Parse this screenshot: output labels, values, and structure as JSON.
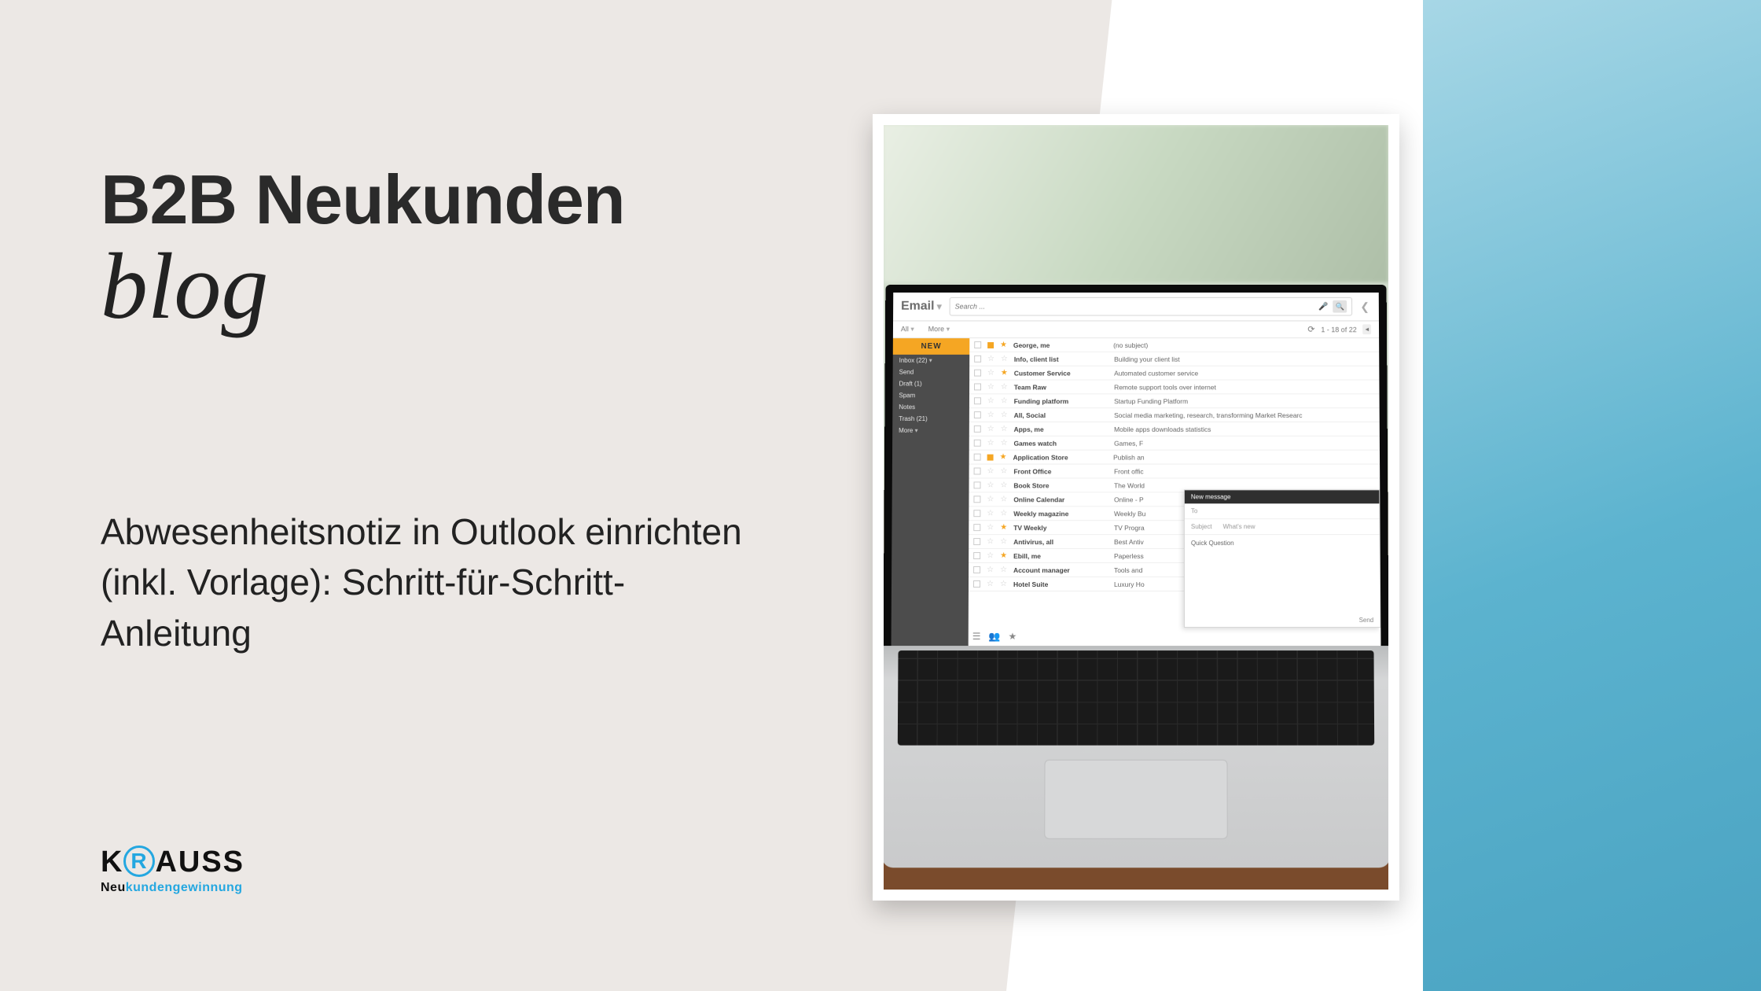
{
  "heading": {
    "line1": "B2B Neukunden",
    "line2": "blog"
  },
  "article_title": "Abwesenheitsnotiz in Outlook einrichten (inkl. Vorlage): Schritt-für-Schritt-Anleitung",
  "logo": {
    "main": "KRAUSS",
    "sub_neu": "Neu",
    "sub_rest": "kundengewinnung"
  },
  "email_app": {
    "title": "Email",
    "search_placeholder": "Search ...",
    "toolbar": {
      "all": "All",
      "more": "More",
      "pagination": "1 - 18 of 22"
    },
    "new_button": "NEW",
    "sidebar": [
      "Inbox (22)",
      "Send",
      "Draft (1)",
      "Spam",
      "Notes",
      "Trash (21)",
      "More"
    ],
    "rows": [
      {
        "sender": "George, me",
        "subject": "(no subject)",
        "starred": true,
        "flag": true
      },
      {
        "sender": "Info, client list",
        "subject": "Building your client list",
        "starred": false,
        "flag": false
      },
      {
        "sender": "Customer Service",
        "subject": "Automated customer service",
        "starred": true,
        "flag": false
      },
      {
        "sender": "Team Raw",
        "subject": "Remote support tools over internet",
        "starred": false,
        "flag": false
      },
      {
        "sender": "Funding platform",
        "subject": "Startup Funding Platform",
        "starred": false,
        "flag": false
      },
      {
        "sender": "All, Social",
        "subject": "Social media marketing, research, transforming Market Researc",
        "starred": false,
        "flag": false
      },
      {
        "sender": "Apps, me",
        "subject": "Mobile apps downloads statistics",
        "starred": false,
        "flag": false
      },
      {
        "sender": "Games watch",
        "subject": "Games, F",
        "starred": false,
        "flag": false
      },
      {
        "sender": "Application Store",
        "subject": "Publish an",
        "starred": true,
        "flag": true
      },
      {
        "sender": "Front Office",
        "subject": "Front offic",
        "starred": false,
        "flag": false
      },
      {
        "sender": "Book Store",
        "subject": "The World",
        "starred": false,
        "flag": false
      },
      {
        "sender": "Online Calendar",
        "subject": "Online - P",
        "starred": false,
        "flag": false
      },
      {
        "sender": "Weekly magazine",
        "subject": "Weekly Bu",
        "starred": false,
        "flag": false
      },
      {
        "sender": "TV Weekly",
        "subject": "TV Progra",
        "starred": true,
        "flag": false
      },
      {
        "sender": "Antivirus, all",
        "subject": "Best Antiv",
        "starred": false,
        "flag": false
      },
      {
        "sender": "Ebill, me",
        "subject": "Paperless",
        "starred": true,
        "flag": false
      },
      {
        "sender": "Account manager",
        "subject": "Tools and",
        "starred": false,
        "flag": false
      },
      {
        "sender": "Hotel Suite",
        "subject": "Luxury Ho",
        "starred": false,
        "flag": false
      }
    ],
    "compose": {
      "header": "New message",
      "to": "To",
      "subject": "Subject",
      "whats_new": "What's new",
      "body": "Quick Question",
      "send": "Send"
    }
  }
}
